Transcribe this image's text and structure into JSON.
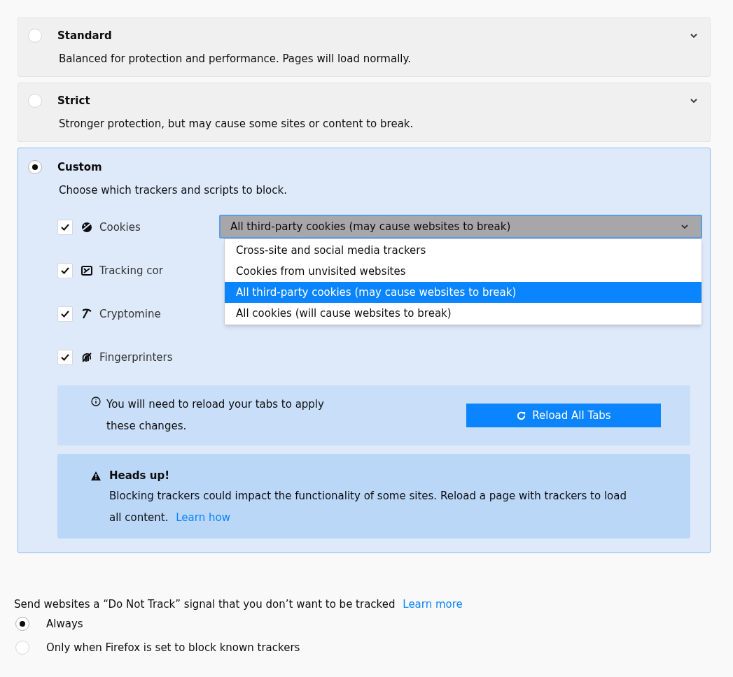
{
  "levels": [
    {
      "label": "Standard",
      "description": "Balanced for protection and performance. Pages will load normally.",
      "selected": false
    },
    {
      "label": "Strict",
      "description": "Stronger protection, but may cause some sites or content to break.",
      "selected": false
    },
    {
      "label": "Custom",
      "description": "Choose which trackers and scripts to block.",
      "selected": true
    }
  ],
  "custom": {
    "trackers": [
      {
        "kind": "cookies",
        "label": "Cookies",
        "checked": true
      },
      {
        "kind": "tracking",
        "label": "Tracking cor",
        "checked": true
      },
      {
        "kind": "crypto",
        "label": "Cryptomine",
        "checked": true
      },
      {
        "kind": "fingerprint",
        "label": "Fingerprinters",
        "checked": true
      }
    ],
    "cookie_select": {
      "value": "All third-party cookies (may cause websites to break)",
      "expanded": true,
      "options": [
        {
          "label": "Cross-site and social media trackers",
          "selected": false
        },
        {
          "label": "Cookies from unvisited websites",
          "selected": false
        },
        {
          "label": "All third-party cookies (may cause websites to break)",
          "selected": true
        },
        {
          "label": "All cookies (will cause websites to break)",
          "selected": false
        }
      ]
    },
    "reload_notice": {
      "text": "You will need to reload your tabs to apply these changes.",
      "button": "Reload All Tabs"
    },
    "warning": {
      "title": "Heads up!",
      "text": "Blocking trackers could impact the functionality of some sites. Reload a page with trackers to load all content.",
      "link": "Learn how"
    }
  },
  "do_not_track": {
    "text": "Send websites a “Do Not Track” signal that you don’t want to be tracked",
    "link": "Learn more",
    "options": [
      {
        "label": "Always",
        "selected": true
      },
      {
        "label": "Only when Firefox is set to block known trackers",
        "selected": false
      }
    ]
  }
}
